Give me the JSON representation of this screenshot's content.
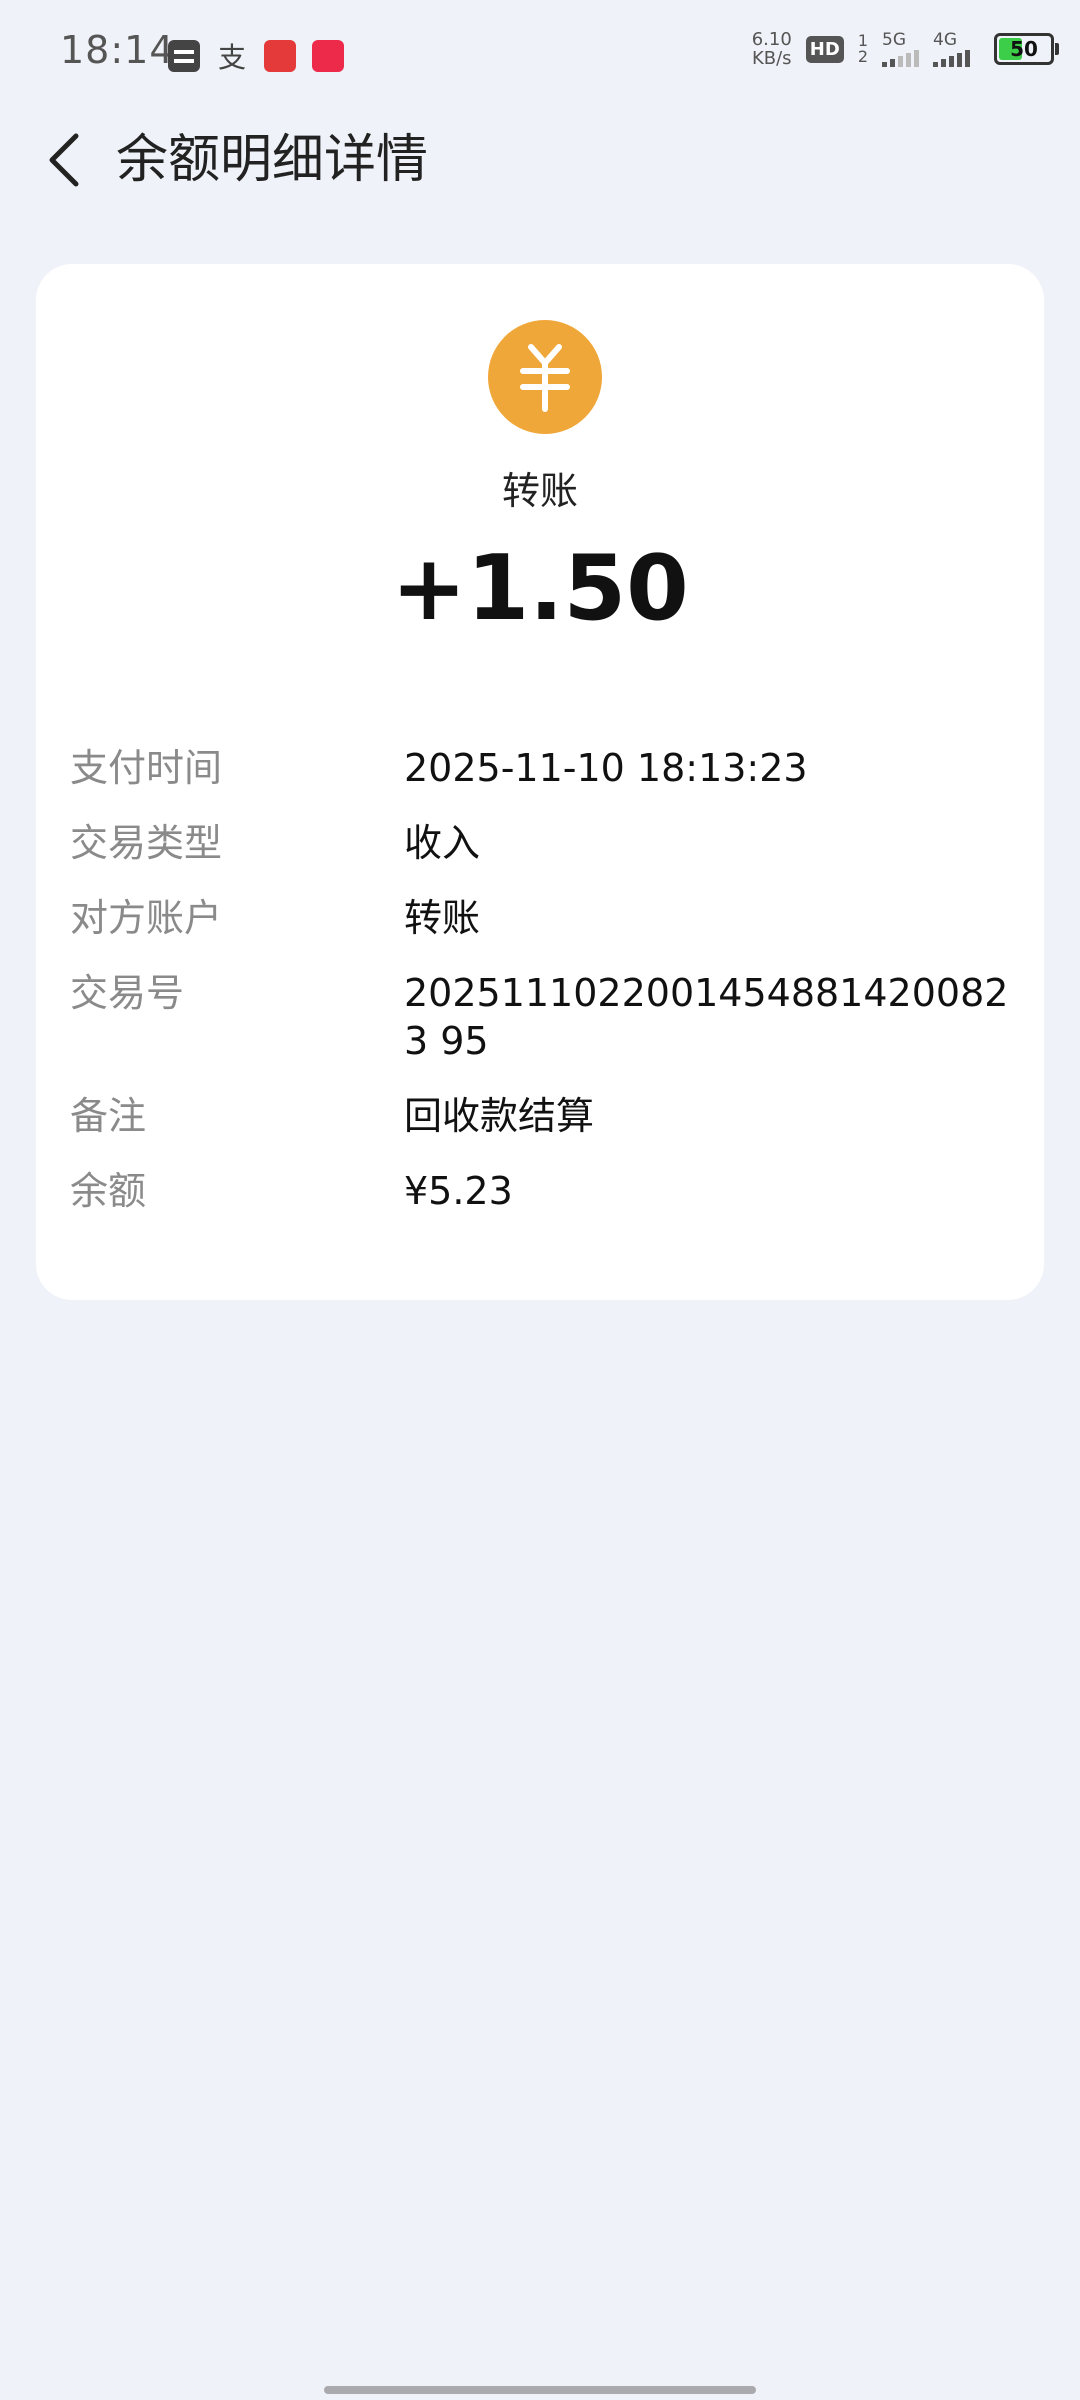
{
  "status_bar": {
    "time": "18:14",
    "net_speed_value": "6.10",
    "net_speed_unit": "KB/s",
    "hd_label": "HD",
    "sim1_label": "1",
    "sim2_label": "2",
    "network1": "5G",
    "network2": "4G",
    "battery_level": 50,
    "battery_text": "50",
    "battery_color": "#3ccd49",
    "zhi_icon": "支"
  },
  "header": {
    "title": "余额明细详情"
  },
  "transaction": {
    "type": "转账",
    "amount": "+1.50",
    "icon_color": "#f0a73a",
    "details": [
      {
        "label": "支付时间",
        "value": "2025-11-10 18:13:23"
      },
      {
        "label": "交易类型",
        "value": "收入"
      },
      {
        "label": "对方账户",
        "value": "转账"
      },
      {
        "label": "交易号",
        "value": "20251110220014548814200823 95"
      },
      {
        "label": "备注",
        "value": "回收款结算"
      },
      {
        "label": "余额",
        "value": "¥5.23"
      }
    ]
  }
}
